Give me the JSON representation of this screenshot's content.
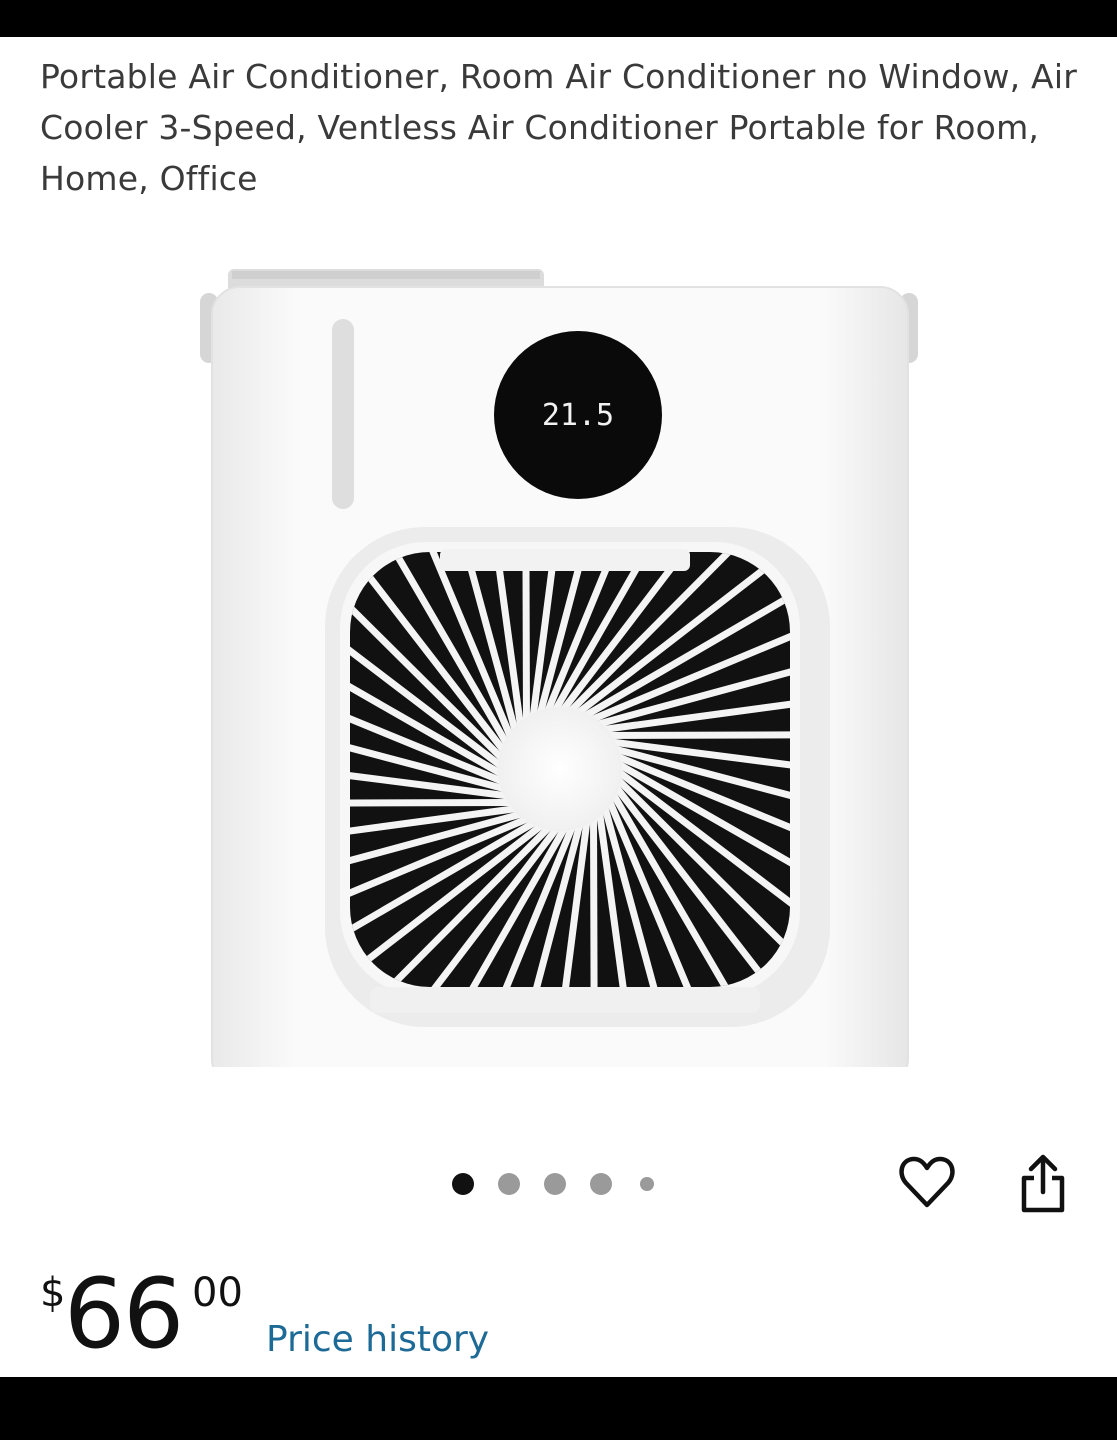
{
  "product": {
    "title": "Portable Air Conditioner, Room Air Conditioner no Window, Air Cooler 3-Speed, Ventless Air Conditioner Portable for Room, Home, Office",
    "display_reading": "21.5"
  },
  "carousel": {
    "image_count": 5,
    "active_index": 0
  },
  "actions": {
    "favorite_icon": "heart-outline-icon",
    "share_icon": "share-icon"
  },
  "price": {
    "symbol": "$",
    "whole": "66",
    "fraction": "00",
    "history_link": "Price history",
    "link_color": "#1d6a96"
  }
}
